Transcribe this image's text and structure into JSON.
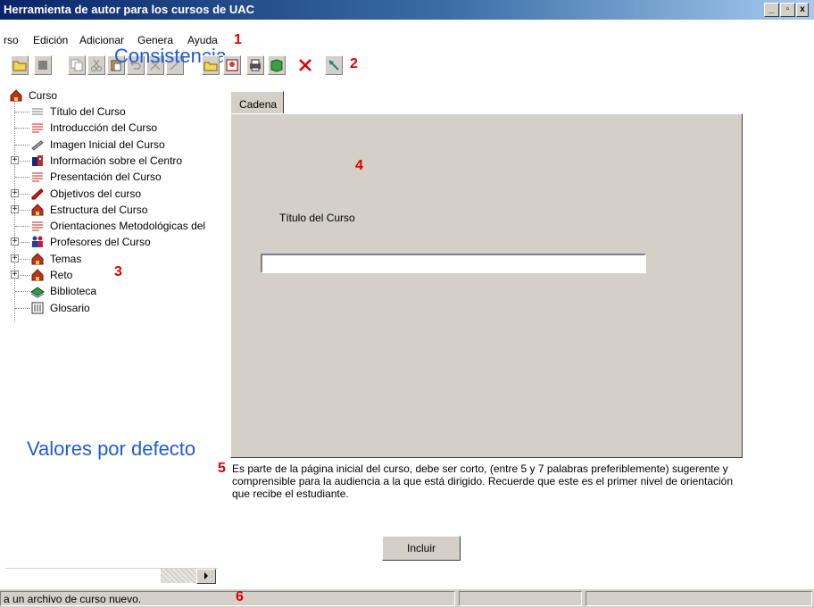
{
  "window": {
    "title": "Herramienta de autor para los cursos de UAC",
    "controls": {
      "minimize": "_",
      "restore": "▫",
      "close": "x"
    }
  },
  "menu": {
    "items": [
      "rso",
      "Edición",
      "Adicionar",
      "Genera",
      "Ayuda"
    ]
  },
  "annotations": {
    "a1": "1",
    "a2": "2",
    "a3": "3",
    "a4": "4",
    "a5": "5",
    "a6": "6",
    "consistencia": "Consistencia",
    "valores": "Valores por defecto"
  },
  "toolbar": {
    "icons": [
      "open-folder-icon",
      "stop-icon",
      "copy-icon",
      "cut-icon",
      "paste-icon",
      "undo-icon",
      "delete-x-icon",
      "new-folder-icon",
      "image-icon",
      "print-icon",
      "book-icon",
      "delete-icon",
      "tool-icon"
    ]
  },
  "tree": {
    "root": "Curso",
    "items": [
      {
        "label": "Título del Curso",
        "icon": "lines-icon",
        "expander": false
      },
      {
        "label": "Introducción del Curso",
        "icon": "text-icon",
        "expander": false
      },
      {
        "label": "Imagen Inicial del Curso",
        "icon": "image-icon",
        "expander": false
      },
      {
        "label": "Información sobre el Centro",
        "icon": "building-icon",
        "expander": true
      },
      {
        "label": "Presentación del Curso",
        "icon": "text-icon",
        "expander": false
      },
      {
        "label": "Objetivos del curso",
        "icon": "pencil-icon",
        "expander": true
      },
      {
        "label": "Estructura del Curso",
        "icon": "house-icon",
        "expander": true
      },
      {
        "label": "Orientaciones Metodológicas del",
        "icon": "text-icon",
        "expander": false
      },
      {
        "label": "Profesores del Curso",
        "icon": "people-icon",
        "expander": true
      },
      {
        "label": "Temas",
        "icon": "house-icon",
        "expander": true
      },
      {
        "label": "Reto",
        "icon": "house-icon",
        "expander": true
      },
      {
        "label": "Biblioteca",
        "icon": "books-icon",
        "expander": false
      },
      {
        "label": "Glosario",
        "icon": "glossary-icon",
        "expander": false
      }
    ]
  },
  "form": {
    "tab_label": "Cadena",
    "field_label": "Título del Curso",
    "field_value": "",
    "help_text": "Es parte de la página inicial del curso, debe ser corto, (entre 5 y 7 palabras preferiblemente) sugerente y comprensible para la audiencia a la que está dirigido. Recuerde que este es el primer nivel de orientación que recibe el estudiante.",
    "submit_label": "Incluir"
  },
  "status": {
    "text": "a un archivo de curso nuevo."
  },
  "colors": {
    "annotation_red": "#e00000",
    "annotation_blue": "#1f5bd6",
    "title_bar": "#0a246a",
    "panel_gray": "#d4d0c8"
  }
}
